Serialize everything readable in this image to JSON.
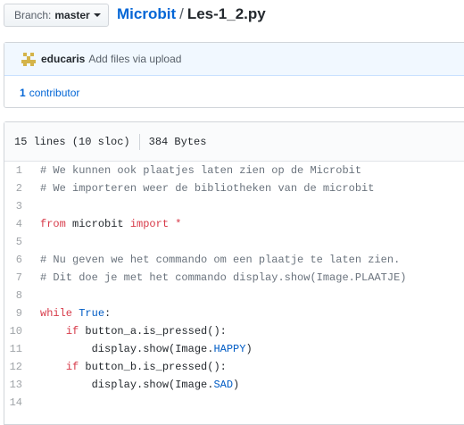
{
  "branch": {
    "prefix": "Branch:",
    "name": "master"
  },
  "breadcrumb": {
    "repo": "Microbit",
    "separator": "/",
    "file": "Les-1_2.py"
  },
  "commit": {
    "author": "educaris",
    "message": "Add files via upload"
  },
  "contributors": {
    "count": "1",
    "label": "contributor"
  },
  "file_info": {
    "lines": "15 lines (10 sloc)",
    "size": "384 Bytes"
  },
  "code": {
    "line_numbers": [
      "1",
      "2",
      "3",
      "4",
      "5",
      "6",
      "7",
      "8",
      "9",
      "10",
      "11",
      "12",
      "13",
      "14"
    ],
    "lines": [
      [
        {
          "t": "# We kunnen ook plaatjes laten zien op de Microbit",
          "c": "c"
        }
      ],
      [
        {
          "t": "# We importeren weer de bibliotheken van de microbit",
          "c": "c"
        }
      ],
      [],
      [
        {
          "t": "from",
          "c": "k"
        },
        {
          "t": " microbit ",
          "c": ""
        },
        {
          "t": "import",
          "c": "k"
        },
        {
          "t": " ",
          "c": ""
        },
        {
          "t": "*",
          "c": "k"
        }
      ],
      [],
      [
        {
          "t": "# Nu geven we het commando om een plaatje te laten zien.",
          "c": "c"
        }
      ],
      [
        {
          "t": "# Dit doe je met het commando display.show(Image.PLAATJE)",
          "c": "c"
        }
      ],
      [],
      [
        {
          "t": "while",
          "c": "k"
        },
        {
          "t": " ",
          "c": ""
        },
        {
          "t": "True",
          "c": "b"
        },
        {
          "t": ":",
          "c": ""
        }
      ],
      [
        {
          "t": "    ",
          "c": ""
        },
        {
          "t": "if",
          "c": "k"
        },
        {
          "t": " button_a.is_pressed():",
          "c": ""
        }
      ],
      [
        {
          "t": "        display.show(Image.",
          "c": ""
        },
        {
          "t": "HAPPY",
          "c": "b"
        },
        {
          "t": ")",
          "c": ""
        }
      ],
      [
        {
          "t": "    ",
          "c": ""
        },
        {
          "t": "if",
          "c": "k"
        },
        {
          "t": " button_b.is_pressed():",
          "c": ""
        }
      ],
      [
        {
          "t": "        display.show(Image.",
          "c": ""
        },
        {
          "t": "SAD",
          "c": "b"
        },
        {
          "t": ")",
          "c": ""
        }
      ],
      []
    ]
  }
}
